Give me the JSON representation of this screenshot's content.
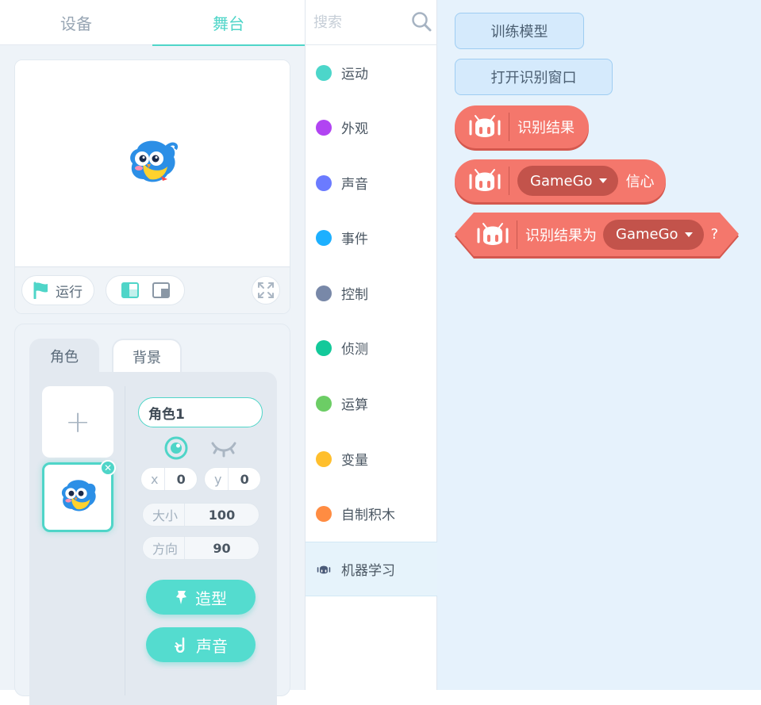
{
  "tabs": [
    {
      "label": "设备",
      "active": false
    },
    {
      "label": "舞台",
      "active": true
    }
  ],
  "stage": {
    "sprite_icon": "owl-bird-sprite",
    "run_label": "运行",
    "run_icon": "flag-icon",
    "layout_icons": [
      "small-stage-icon",
      "large-stage-icon"
    ],
    "fullscreen_icon": "fullscreen-icon"
  },
  "sprite_panel": {
    "tabs": [
      "角色",
      "背景"
    ],
    "add_label": "+",
    "name_value": "角色1",
    "x_label": "x",
    "x_value": "0",
    "y_label": "y",
    "y_value": "0",
    "size_label": "大小",
    "size_value": "100",
    "direction_label": "方向",
    "direction_value": "90",
    "costume_label": "造型",
    "sound_label": "声音",
    "delete_icon": "close-icon"
  },
  "search": {
    "placeholder": "搜索"
  },
  "categories": [
    {
      "label": "运动",
      "color": "#4cd6ca"
    },
    {
      "label": "外观",
      "color": "#b144f2"
    },
    {
      "label": "声音",
      "color": "#6b7bff"
    },
    {
      "label": "事件",
      "color": "#1db0ff"
    },
    {
      "label": "控制",
      "color": "#7888a8"
    },
    {
      "label": "侦测",
      "color": "#13c99a"
    },
    {
      "label": "运算",
      "color": "#6ccd65"
    },
    {
      "label": "变量",
      "color": "#ffbf2d"
    },
    {
      "label": "自制积木",
      "color": "#ff8c42"
    },
    {
      "label": "机器学习",
      "color": "#4a5a78",
      "icon": "robot-icon",
      "selected": true
    }
  ],
  "workspace": {
    "train_button": "训练模型",
    "open_button": "打开识别窗口",
    "block_result": "识别结果",
    "block_confidence_dropdown": "GameGo",
    "block_confidence_suffix": "信心",
    "block_is_prefix": "识别结果为",
    "block_is_dropdown": "GameGo",
    "block_is_suffix": "?",
    "block_color": "#f4776c"
  }
}
